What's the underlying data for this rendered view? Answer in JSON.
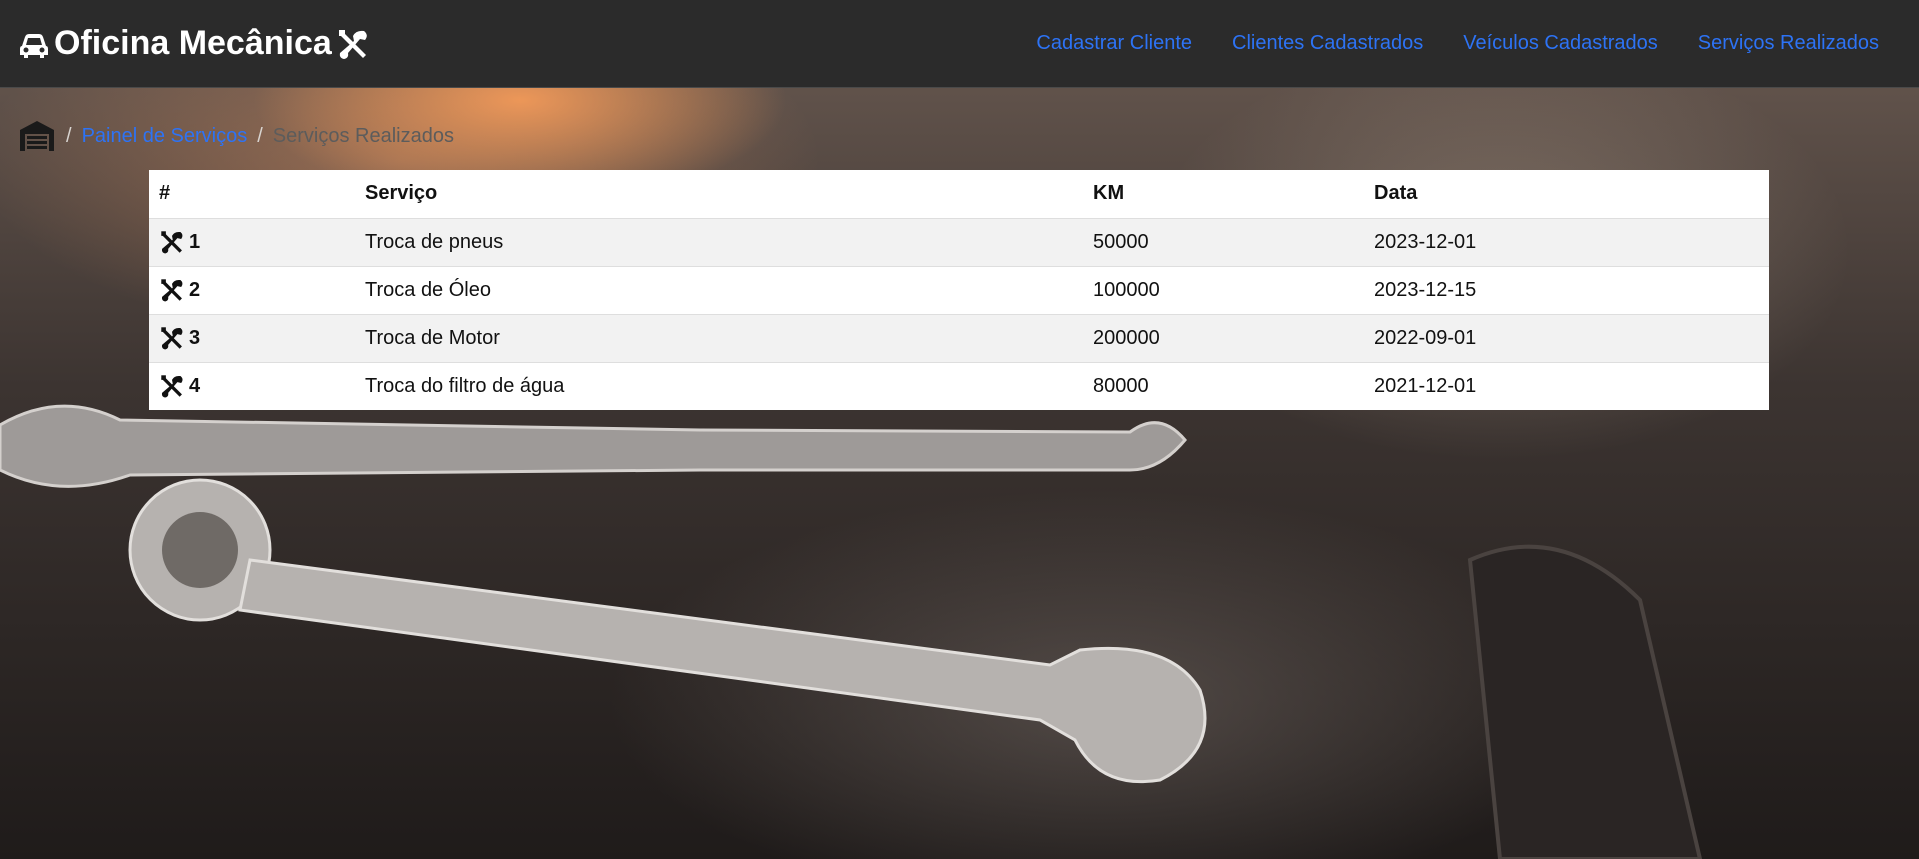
{
  "navbar": {
    "brand_text": "Oficina Mecânica",
    "brand_left_icon": "car-icon",
    "brand_right_icon": "tools-icon",
    "links": [
      {
        "label": "Cadastrar Cliente"
      },
      {
        "label": "Clientes Cadastrados"
      },
      {
        "label": "Veículos Cadastrados"
      },
      {
        "label": "Serviços Realizados"
      }
    ]
  },
  "breadcrumb": {
    "home_icon": "garage-icon",
    "separator": "/",
    "items": [
      {
        "label": "Painel de Serviços"
      },
      {
        "label": "Serviços Realizados"
      }
    ]
  },
  "table": {
    "columns": [
      "#",
      "Serviço",
      "KM",
      "Data"
    ],
    "row_icon": "tools-icon",
    "rows": [
      {
        "id": "1",
        "service": "Troca de pneus",
        "km": "50000",
        "date": "2023-12-01"
      },
      {
        "id": "2",
        "service": "Troca de Óleo",
        "km": "100000",
        "date": "2023-12-15"
      },
      {
        "id": "3",
        "service": "Troca de Motor",
        "km": "200000",
        "date": "2022-09-01"
      },
      {
        "id": "4",
        "service": "Troca do filtro de água",
        "km": "80000",
        "date": "2021-12-01"
      }
    ]
  },
  "colors": {
    "navbar_bg": "#2b2b2b",
    "link": "#2d73f5",
    "brand_text": "#ffffff",
    "breadcrumb_current": "#5c5c5c",
    "row_striped": "#f2f2f2"
  }
}
